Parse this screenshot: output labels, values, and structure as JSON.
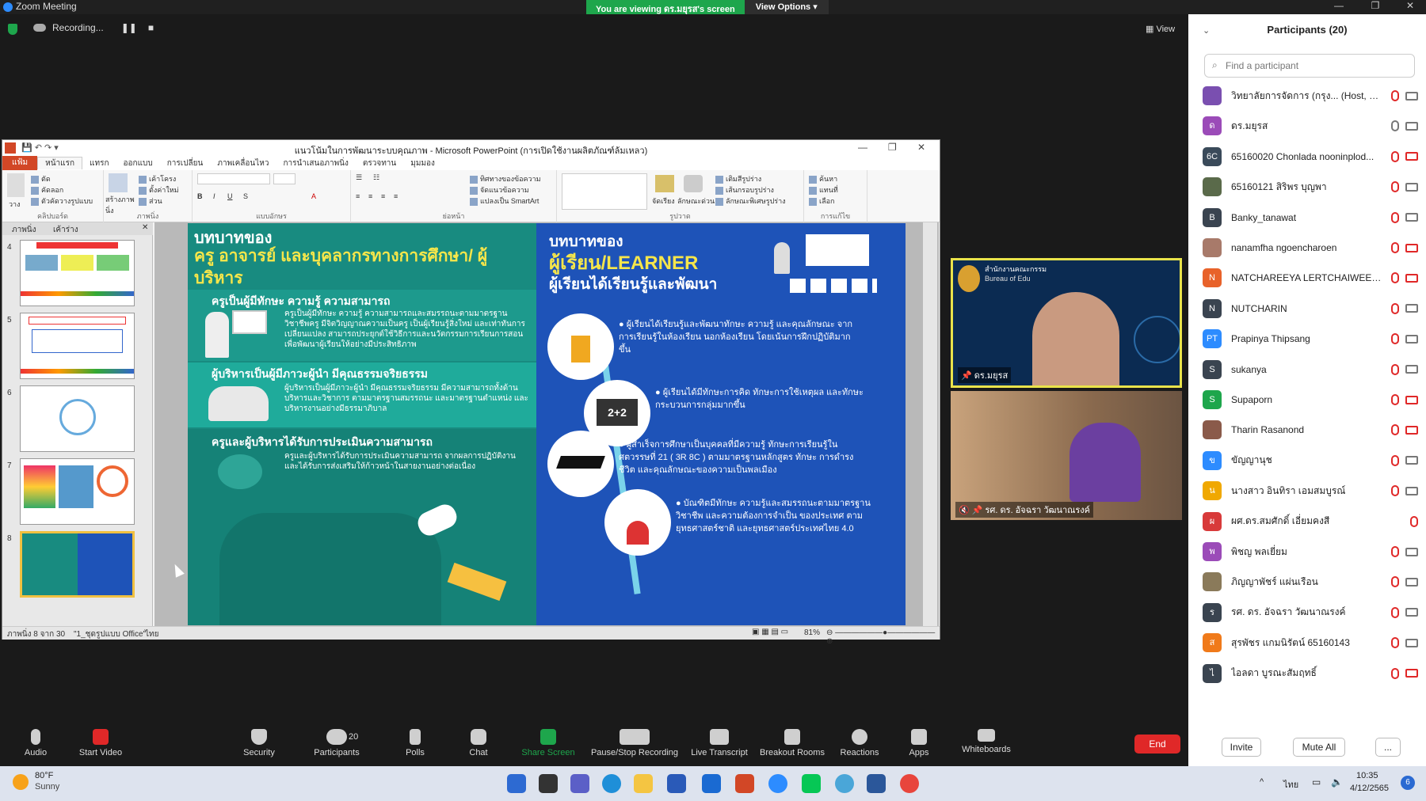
{
  "app": {
    "title": "Zoom Meeting"
  },
  "share_banner": {
    "viewing_text": "You are viewing ดร.มยุรส's screen",
    "view_options": "View Options"
  },
  "recording": {
    "label": "Recording..."
  },
  "view_button": "View",
  "ppt": {
    "title": "แนวโน้มในการพัฒนาระบบคุณภาพ - Microsoft PowerPoint (การเปิดใช้งานผลิตภัณฑ์ล้มเหลว)",
    "tabs": [
      "แฟ้ม",
      "หน้าแรก",
      "แทรก",
      "ออกแบบ",
      "การเปลี่ยน",
      "ภาพเคลื่อนไหว",
      "การนำเสนอภาพนิ่ง",
      "ตรวจทาน",
      "มุมมอง"
    ],
    "ribbon": {
      "clipboard": {
        "label": "คลิปบอร์ด",
        "paste": "วาง",
        "cut": "ตัด",
        "copy": "คัดลอก",
        "format_painter": "ตัวคัดวางรูปแบบ"
      },
      "slides": {
        "label": "ภาพนิ่ง",
        "new_slide": "สร้างภาพนิ่ง",
        "layout": "เค้าโครง",
        "reset": "ตั้งค่าใหม่",
        "section": "ส่วน"
      },
      "font": {
        "label": "แบบอักษร"
      },
      "paragraph": {
        "label": "ย่อหน้า",
        "text_direction": "ทิศทางของข้อความ",
        "align_text": "จัดแนวข้อความ",
        "convert_smartart": "แปลงเป็น SmartArt"
      },
      "drawing": {
        "label": "รูปวาด",
        "arrange": "จัดเรียง",
        "quick_styles": "ลักษณะด่วน",
        "shape_fill": "เติมสีรูปร่าง",
        "shape_outline": "เส้นกรอบรูปร่าง",
        "shape_effects": "ลักษณะพิเศษรูปร่าง"
      },
      "editing": {
        "label": "การแก้ไข",
        "find": "ค้นหา",
        "replace": "แทนที่",
        "select": "เลือก"
      }
    },
    "pane_tabs": [
      "ภาพนิ่ง",
      "เค้าร่าง"
    ],
    "thumb_numbers": [
      "4",
      "5",
      "6",
      "7",
      "8"
    ],
    "status": {
      "slide_of": "ภาพนิ่ง 8 จาก 30",
      "theme": "\"1_ชุดรูปแบบ Office\"",
      "lang": "ไทย",
      "zoom": "81%"
    },
    "slide": {
      "left": {
        "heading1": "บทบาทของ",
        "heading2": "ครู อาจารย์ และบุคลากรทางการศึกษา/ ผู้บริหาร",
        "s1_title": "ครูเป็นผู้มีทักษะ ความรู้ ความสามารถ",
        "s1_text": "ครูเป็นผู้มีทักษะ ความรู้ ความสามารถและสมรรถนะตามมาตรฐานวิชาชีพครู มีจิตวิญญาณความเป็นครู เป็นผู้เรียนรู้สิ่งใหม่ และเท่าทันการเปลี่ยนแปลง สามารถประยุกต์ใช้วิธีการและนวัตกรรมการเรียนการสอน เพื่อพัฒนาผู้เรียนให้อย่างมีประสิทธิภาพ",
        "s2_title": "ผู้บริหารเป็นผู้มีภาวะผู้นำ มีคุณธรรมจริยธรรม",
        "s2_text": "ผู้บริหารเป็นผู้มีภาวะผู้นำ มีคุณธรรมจริยธรรม มีความสามารถทั้งด้านบริหารและวิชาการ ตามมาตรฐานสมรรถนะ และมาตรฐานตำแหน่ง และบริหารงานอย่างมีธรรมาภิบาล",
        "s3_title": "ครูและผู้บริหารได้รับการประเมินความสามารถ",
        "s3_text": "ครูและผู้บริหารได้รับการประเมินความสามารถ จากผลการปฏิบัติงาน และได้รับการส่งเสริมให้ก้าวหน้าในสายงานอย่างต่อเนื่อง"
      },
      "right": {
        "heading1": "บทบาทของ",
        "heading2": "ผู้เรียน/LEARNER",
        "heading3": "ผู้เรียนได้เรียนรู้และพัฒนา",
        "b1": "ผู้เรียนได้เรียนรู้และพัฒนาทักษะ ความรู้ และคุณลักษณะ จากการเรียนรู้ในห้องเรียน นอกห้องเรียน โดยเน้นการฝึกปฏิบัติมากขึ้น",
        "b2": "ผู้เรียนได้มีทักษะการคิด ทักษะการใช้เหตุผล และทักษะกระบวนการกลุ่มมากขึ้น",
        "b3": "ผู้สำเร็จการศึกษาเป็นบุคคลที่มีความรู้ ทักษะการเรียนรู้ในศตวรรษที่ 21 ( 3R 8C ) ตามมาตรฐานหลักสูตร ทักษะ การดำรงชีวิต และคุณลักษณะของความเป็นพลเมือง",
        "b4": "บัณฑิตมีทักษะ ความรู้และสมรรถนะตามมาตรฐานวิชาชีพ และความต้องการจำเป็น ของประเทศ ตามยุทธศาสตร์ชาติ และยุทธศาสตร์ประเทศไทย 4.0",
        "icon_2plus2": "2+2"
      }
    }
  },
  "videos": [
    {
      "name": "ดร.มยุรส",
      "org_line1": "สำนักงานคณะกรรม",
      "org_line2": "Bureau of Edu"
    },
    {
      "name": "รศ. ดร. อัจฉรา วัฒนาณรงค์"
    }
  ],
  "toolbar": {
    "items": [
      {
        "label": "Audio"
      },
      {
        "label": "Start Video"
      },
      {
        "label": "Security"
      },
      {
        "label": "Participants",
        "count": "20"
      },
      {
        "label": "Polls"
      },
      {
        "label": "Chat"
      },
      {
        "label": "Share Screen"
      },
      {
        "label": "Pause/Stop Recording"
      },
      {
        "label": "Live Transcript"
      },
      {
        "label": "Breakout Rooms"
      },
      {
        "label": "Reactions"
      },
      {
        "label": "Apps"
      },
      {
        "label": "Whiteboards"
      }
    ],
    "end": "End"
  },
  "panel": {
    "title": "Participants (20)",
    "search_placeholder": "Find a participant",
    "participants": [
      {
        "initials": "",
        "name": "วิทยาลัยการจัดการ (กรุง... (Host, me)",
        "color": "#7a4fb0"
      },
      {
        "initials": "ด",
        "name": "ดร.มยุรส",
        "color": "#9b4bb8"
      },
      {
        "initials": "6C",
        "name": "65160020 Chonlada nooninplod...",
        "color": "#3a4a5a"
      },
      {
        "initials": "",
        "name": "65160121 สิริพร บุญพา",
        "color": "#5a6a4a"
      },
      {
        "initials": "B",
        "name": "Banky_tanawat",
        "color": "#3a4450"
      },
      {
        "initials": "",
        "name": "nanamfha ngoencharoen",
        "color": "#a87a6a"
      },
      {
        "initials": "N",
        "name": "NATCHAREEYA LERTCHAIWEERA...",
        "color": "#e8622a"
      },
      {
        "initials": "N",
        "name": "NUTCHARIN",
        "color": "#3a4450"
      },
      {
        "initials": "PT",
        "name": "Prapinya Thipsang",
        "color": "#2d8cff"
      },
      {
        "initials": "S",
        "name": "sukanya",
        "color": "#3a4450"
      },
      {
        "initials": "S",
        "name": "Supaporn",
        "color": "#1ea64c"
      },
      {
        "initials": "",
        "name": "Tharin Rasanond",
        "color": "#8a5a4a"
      },
      {
        "initials": "ข",
        "name": "ขัญญานุช",
        "color": "#2d8cff"
      },
      {
        "initials": "น",
        "name": "นางสาว อินทิรา เอมสมบูรณ์",
        "color": "#f0a800"
      },
      {
        "initials": "ผ",
        "name": "ผศ.ดร.สมศักดิ์ เอี่ยมคงสี",
        "color": "#d83a3a"
      },
      {
        "initials": "พ",
        "name": "พิชญ พลเยี่ยม",
        "color": "#9b4bb8"
      },
      {
        "initials": "",
        "name": "ภิญญาพัชร์ แผ่นเรือน",
        "color": "#8a7a5a"
      },
      {
        "initials": "ร",
        "name": "รศ. ดร. อัจฉรา วัฒนาณรงค์",
        "color": "#3a4450"
      },
      {
        "initials": "ส",
        "name": "สุรพัชร แกมนิรัตน์ 65160143",
        "color": "#f07a1a"
      },
      {
        "initials": "ไ",
        "name": "ไอลดา บูรณะสัมฤทธิ์",
        "color": "#3a4450"
      }
    ],
    "invite": "Invite",
    "mute_all": "Mute All",
    "more": "..."
  },
  "taskbar": {
    "weather_temp": "80°F",
    "weather_desc": "Sunny",
    "lang": "ไทย",
    "time": "10:35",
    "date": "4/12/2565",
    "badge": "6"
  }
}
